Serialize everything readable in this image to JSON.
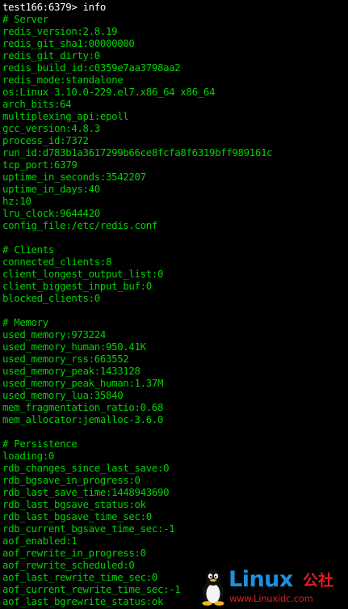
{
  "terminal": {
    "prompt": "test166:6379> info",
    "lines": [
      "# Server",
      "redis_version:2.8.19",
      "redis_git_sha1:00000000",
      "redis_git_dirty:0",
      "redis_build_id:c0359e7aa3798aa2",
      "redis_mode:standalone",
      "os:Linux 3.10.0-229.el7.x86_64 x86_64",
      "arch_bits:64",
      "multiplexing_api:epoll",
      "gcc_version:4.8.3",
      "process_id:7372",
      "run_id:d783b1a3617299b66ce8fcfa8f6319bff989161c",
      "tcp_port:6379",
      "uptime_in_seconds:3542207",
      "uptime_in_days:40",
      "hz:10",
      "lru_clock:9644420",
      "config_file:/etc/redis.conf",
      "",
      "# Clients",
      "connected_clients:8",
      "client_longest_output_list:0",
      "client_biggest_input_buf:0",
      "blocked_clients:0",
      "",
      "# Memory",
      "used_memory:973224",
      "used_memory_human:950.41K",
      "used_memory_rss:663552",
      "used_memory_peak:1433128",
      "used_memory_peak_human:1.37M",
      "used_memory_lua:35840",
      "mem_fragmentation_ratio:0.68",
      "mem_allocator:jemalloc-3.6.0",
      "",
      "# Persistence",
      "loading:0",
      "rdb_changes_since_last_save:0",
      "rdb_bgsave_in_progress:0",
      "rdb_last_save_time:1448943690",
      "rdb_last_bgsave_status:ok",
      "rdb_last_bgsave_time_sec:0",
      "rdb_current_bgsave_time_sec:-1",
      "aof_enabled:1",
      "aof_rewrite_in_progress:0",
      "aof_rewrite_scheduled:0",
      "aof_last_rewrite_time_sec:0",
      "aof_current_rewrite_time_sec:-1",
      "aof_last_bgrewrite_status:ok"
    ]
  },
  "watermark": {
    "word": "Linux",
    "cjk": "公社",
    "url": "www.Linuxidc.com",
    "icon": "tux-penguin-icon"
  },
  "colors": {
    "background": "#000000",
    "prompt": "#ffffff",
    "output": "#00d200",
    "watermark_blue": "#1c8fe0",
    "watermark_red": "#e31b23"
  }
}
